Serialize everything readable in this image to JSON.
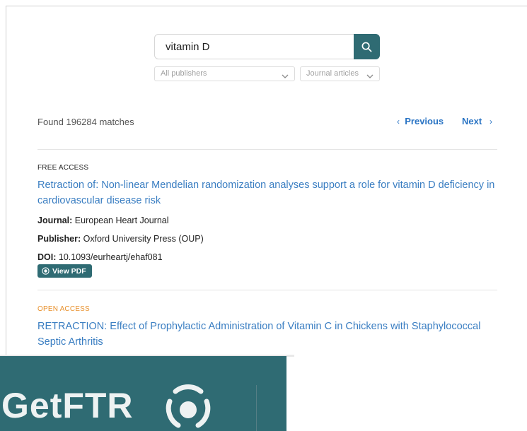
{
  "search": {
    "value": "vitamin D",
    "publisher_filter": "All publishers",
    "type_filter": "Journal articles"
  },
  "results_header": {
    "found_text": "Found 196284 matches",
    "previous_label": "Previous",
    "next_label": "Next"
  },
  "results": [
    {
      "access": "FREE ACCESS",
      "title": "Retraction of: Non-linear Mendelian randomization analyses support a role for vitamin D deficiency in cardiovascular disease risk",
      "journal_label": "Journal:",
      "journal": "European Heart Journal",
      "publisher_label": "Publisher:",
      "publisher": "Oxford University Press (OUP)",
      "doi_label": "DOI:",
      "doi": "10.1093/eurheartj/ehaf081",
      "pdf_label": "View PDF"
    },
    {
      "access": "OPEN ACCESS",
      "title": "RETRACTION: Effect of Prophylactic Administration of Vitamin C in Chickens with Staphylococcal Septic Arthritis"
    }
  ],
  "banner": {
    "brand": "GetFTR"
  },
  "colors": {
    "accent": "#2f6b73",
    "link": "#3a7ec2",
    "open_access": "#e8912d"
  }
}
